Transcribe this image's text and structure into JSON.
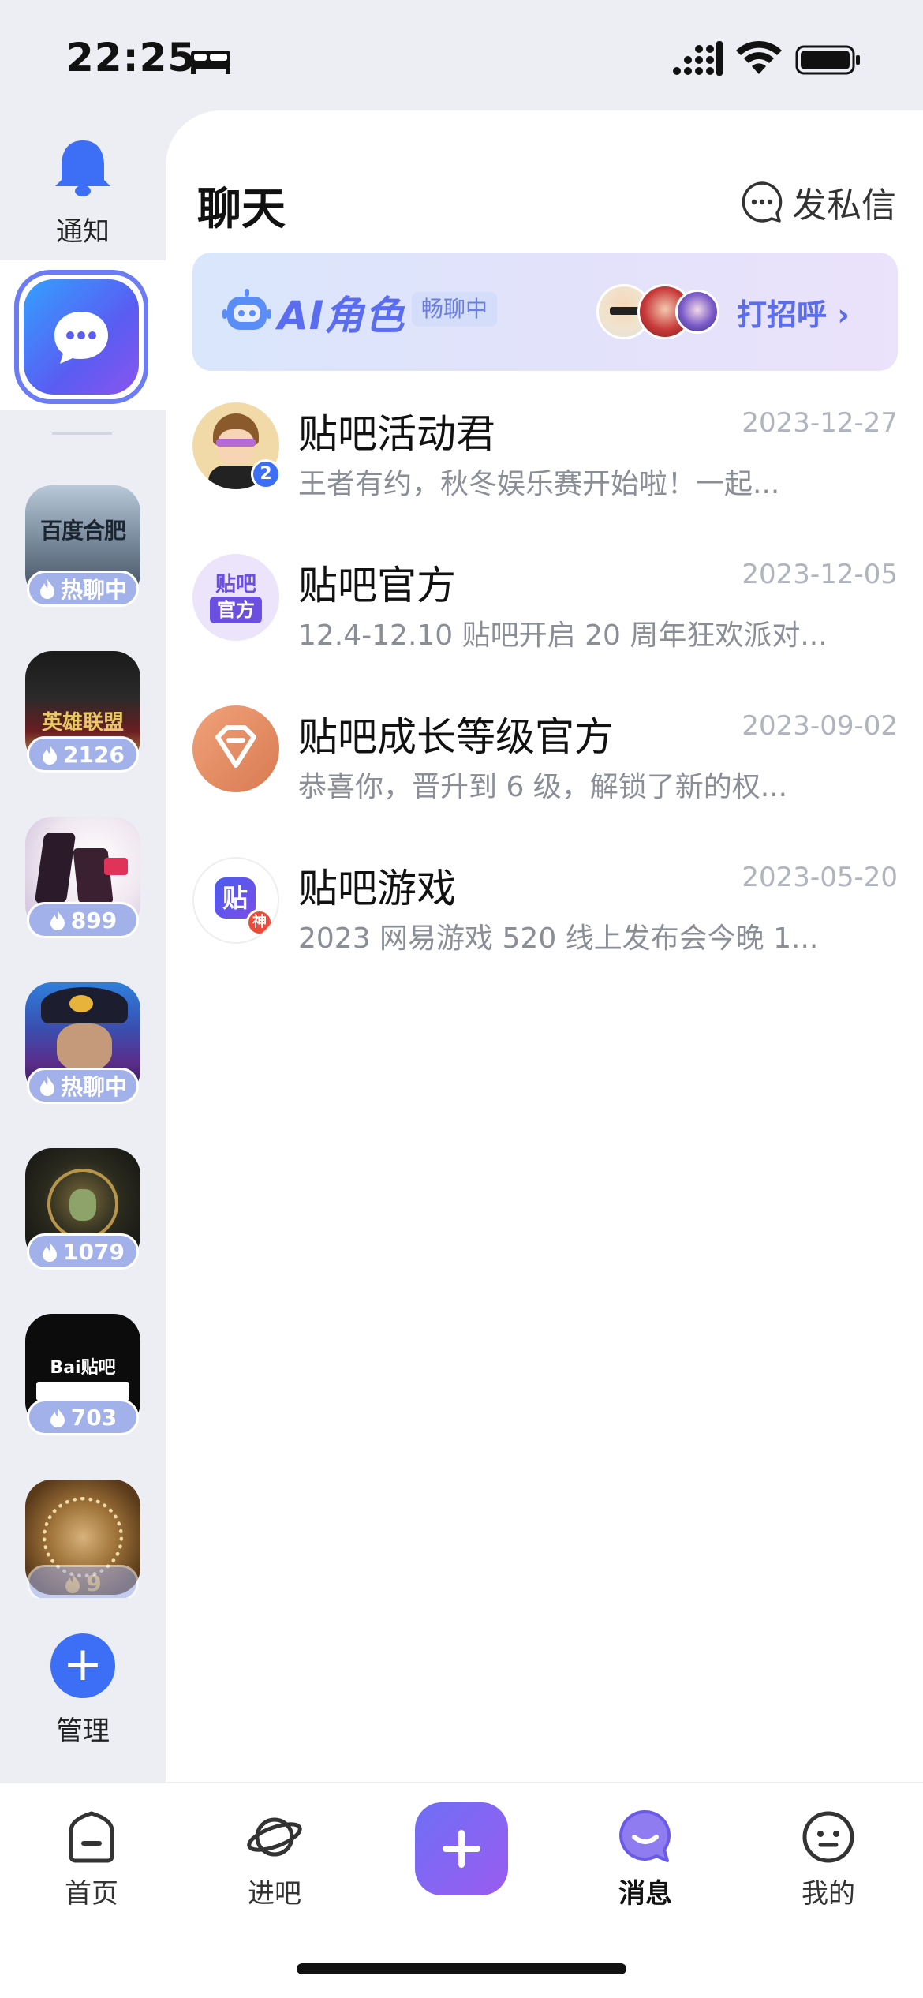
{
  "status_bar": {
    "time": "22:25"
  },
  "rail": {
    "notify_label": "通知",
    "manage_label": "管理",
    "forums": [
      {
        "badge": "热聊中",
        "name_art": "百度合肥"
      },
      {
        "badge": "2126",
        "name_art": "英雄联盟"
      },
      {
        "badge": "899",
        "name_art": ""
      },
      {
        "badge": "热聊中",
        "name_art": ""
      },
      {
        "badge": "1079",
        "name_art": ""
      },
      {
        "badge": "703",
        "name_art": "Bai贴吧"
      },
      {
        "badge": "9",
        "name_art": ""
      }
    ]
  },
  "header": {
    "title": "聊天",
    "compose_label": "发私信"
  },
  "ai_banner": {
    "title": "AI角色",
    "tag": "畅聊中",
    "cta": "打招呼 ›"
  },
  "messages": [
    {
      "name": "贴吧活动君",
      "date": "2023-12-27",
      "preview": "王者有约，秋冬娱乐赛开始啦！一起...",
      "badge": "2"
    },
    {
      "name": "贴吧官方",
      "date": "2023-12-05",
      "preview": "12.4-12.10 贴吧开启 20 周年狂欢派对...",
      "avatar_text_top": "贴吧",
      "avatar_text_bottom": "官方"
    },
    {
      "name": "贴吧成长等级官方",
      "date": "2023-09-02",
      "preview": "恭喜你，晋升到 6 级，解锁了新的权..."
    },
    {
      "name": "贴吧游戏",
      "date": "2023-05-20",
      "preview": "2023 网易游戏 520 线上发布会今晚 1...",
      "avatar_text": "贴",
      "avatar_badge": "神"
    }
  ],
  "tabs": [
    {
      "label": "首页",
      "icon": "home-icon"
    },
    {
      "label": "进吧",
      "icon": "planet-icon"
    },
    {
      "label": "消息",
      "icon": "message-icon",
      "active": true
    },
    {
      "label": "我的",
      "icon": "profile-icon"
    }
  ],
  "colors": {
    "accent": "#5a6df0",
    "badge": "#a3b1ea",
    "add_button": "#3d6ef6"
  }
}
